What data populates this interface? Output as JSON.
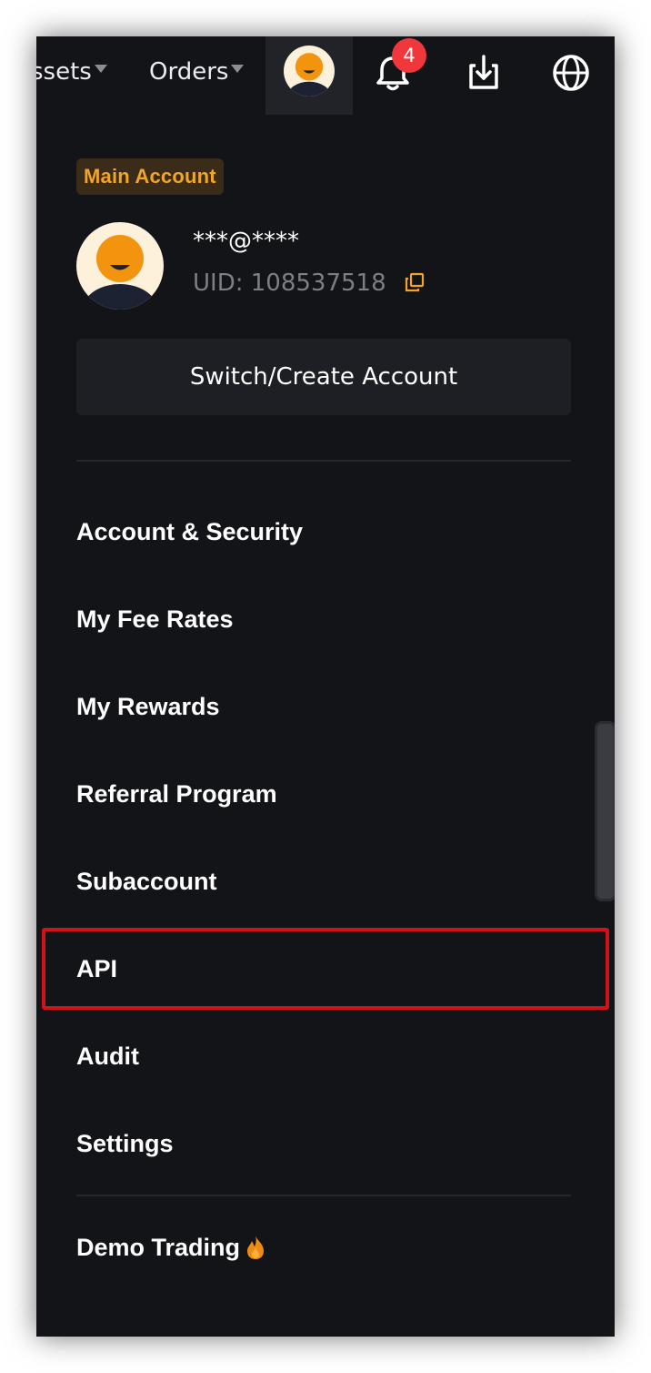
{
  "nav": {
    "assets_label": "ssets",
    "orders_label": "Orders",
    "notification_count": "4"
  },
  "account": {
    "type_badge": "Main Account",
    "email": "***@****",
    "uid": "UID: 108537518",
    "switch_label": "Switch/Create Account"
  },
  "menu": {
    "items": [
      {
        "label": "Account & Security"
      },
      {
        "label": "My Fee Rates"
      },
      {
        "label": "My Rewards"
      },
      {
        "label": "Referral Program"
      },
      {
        "label": "Subaccount"
      },
      {
        "label": "API"
      },
      {
        "label": "Audit"
      },
      {
        "label": "Settings"
      }
    ],
    "demo_label": "Demo Trading"
  },
  "colors": {
    "background": "#131418",
    "accent": "#f0a52a",
    "badge": "#f0373b",
    "highlight": "#d0121b"
  },
  "icons": [
    "caret-down-icon",
    "avatar-icon",
    "bell-icon",
    "download-icon",
    "globe-icon",
    "copy-icon",
    "fire-icon"
  ]
}
